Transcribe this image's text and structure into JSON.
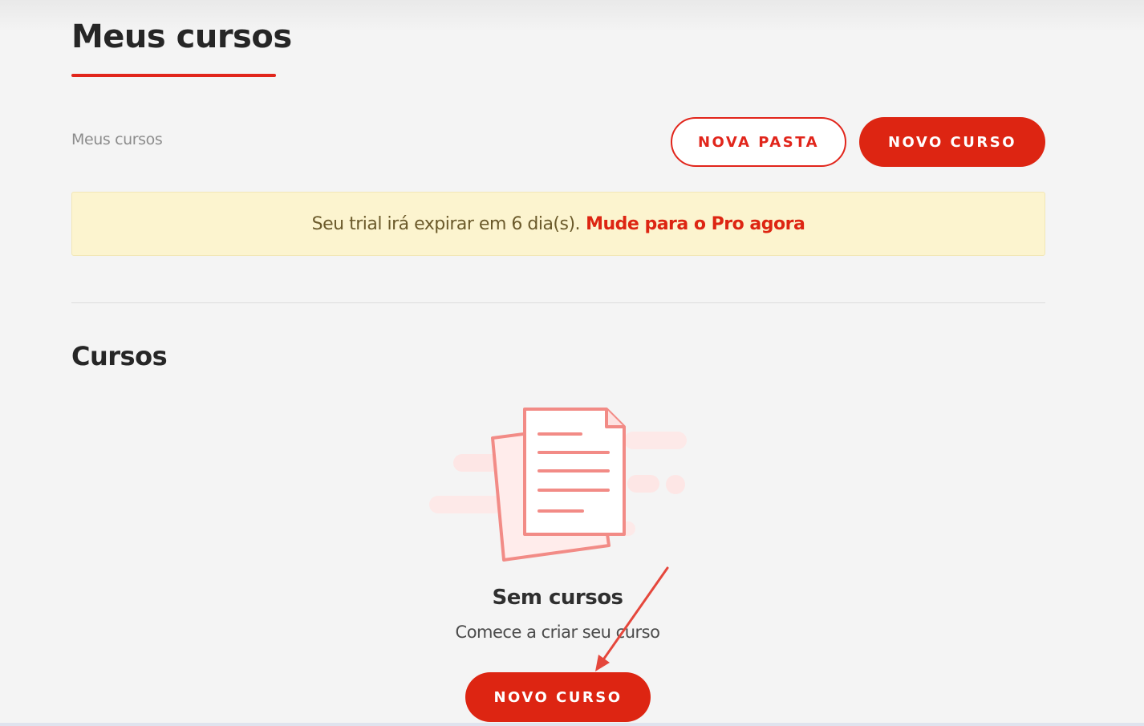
{
  "header": {
    "title": "Meus cursos"
  },
  "toolbar": {
    "breadcrumb": "Meus cursos",
    "new_folder_label": "NOVA PASTA",
    "new_course_label": "NOVO CURSO"
  },
  "trial_banner": {
    "message": "Seu trial irá expirar em 6 dia(s).",
    "upgrade_link": "Mude para o Pro agora"
  },
  "courses_section": {
    "title": "Cursos",
    "empty_state": {
      "icon": "documents-icon",
      "title": "Sem cursos",
      "subtitle": "Comece a criar seu curso",
      "button_label": "NOVO CURSO"
    }
  },
  "colors": {
    "accent": "#dd2512",
    "banner_background": "#fcf4cf",
    "background": "#f4f4f4"
  }
}
